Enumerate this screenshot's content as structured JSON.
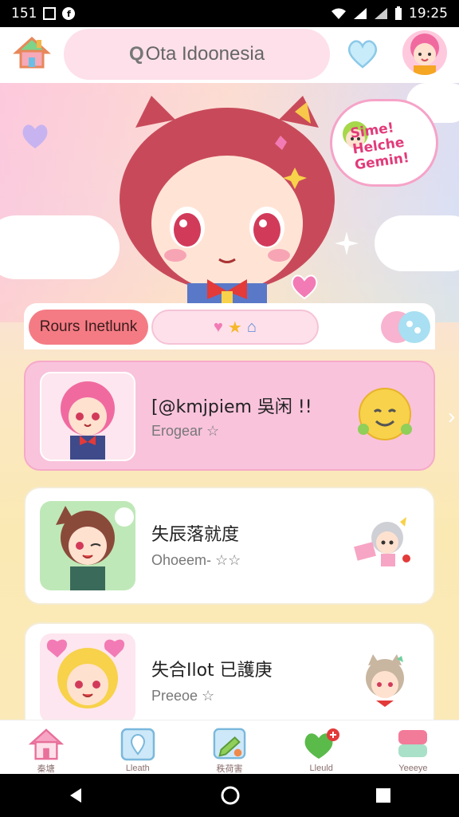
{
  "status_bar": {
    "left_text": "151",
    "time": "19:25"
  },
  "app_bar": {
    "search_label": "Ota Idoonesia",
    "search_prefix": "Q"
  },
  "hero": {
    "bubble_text": "Sime! Helche Gemin!"
  },
  "tabs": {
    "active_label": "Rours Inetlunk",
    "icons": [
      "heart-icon",
      "star-icon",
      "home-icon"
    ]
  },
  "cards": [
    {
      "title": "[@kmjpiem 吳闲 !!",
      "subtitle": "Erogear ☆"
    },
    {
      "title": "失辰落就度",
      "subtitle": "Ohoeem- ☆☆"
    },
    {
      "title": "失合Ilot 已護庚",
      "subtitle": "Preeoe ☆"
    }
  ],
  "bottom_nav": [
    {
      "label": "秦塘",
      "icon": "home-icon"
    },
    {
      "label": "Lleath",
      "icon": "map-pin-icon"
    },
    {
      "label": "秩荷害",
      "icon": "edit-icon"
    },
    {
      "label": "Lleuld",
      "icon": "heart-chat-icon"
    },
    {
      "label": "Yeeeye",
      "icon": "box-icon"
    }
  ],
  "colors": {
    "accent_pink": "#f9c3dc",
    "tab_active": "#f47b84",
    "bubble_text": "#e23a7a"
  }
}
